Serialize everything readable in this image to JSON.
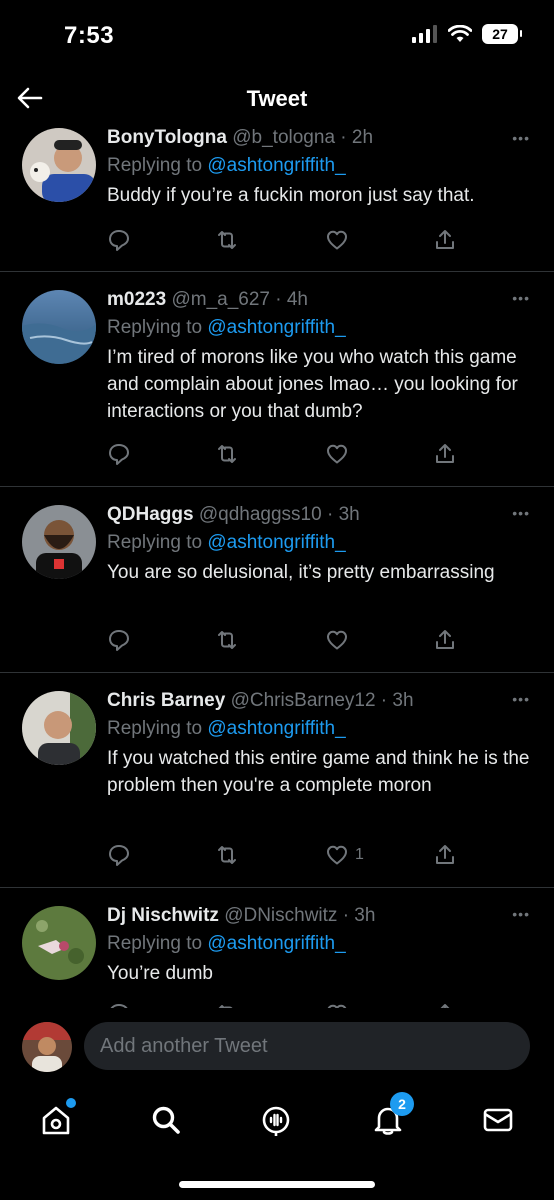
{
  "status_bar": {
    "time": "7:53",
    "battery": "27"
  },
  "header": {
    "title": "Tweet"
  },
  "tweets": [
    {
      "name": "BonyTologna",
      "handle": "@b_tologna · 2h",
      "replying_prefix": "Replying to",
      "replying_to": "@ashtongriffith_",
      "text": "Buddy if you’re a fuckin moron just say that.",
      "likes": ""
    },
    {
      "name": "m0223",
      "handle": "@m_a_627 · 4h",
      "replying_prefix": "Replying to",
      "replying_to": "@ashtongriffith_",
      "text": "I’m tired of morons like you who watch this game and complain about jones lmao… you looking for interactions or you that dumb?",
      "likes": ""
    },
    {
      "name": "QDHaggs",
      "handle": "@qdhaggss10 · 3h",
      "replying_prefix": "Replying to",
      "replying_to": "@ashtongriffith_",
      "text": "You are so delusional, it’s pretty embarrassing",
      "likes": ""
    },
    {
      "name": "Chris Barney",
      "handle": "@ChrisBarney12 · 3h",
      "replying_prefix": "Replying to",
      "replying_to": "@ashtongriffith_",
      "text": "If you watched this entire game and think he is the problem then you're a complete moron",
      "likes": "1"
    },
    {
      "name": "Dj Nischwitz",
      "handle": "@DNischwitz · 3h",
      "replying_prefix": "Replying to",
      "replying_to": "@ashtongriffith_",
      "text": "You’re dumb",
      "likes": ""
    }
  ],
  "compose": {
    "placeholder": "Add another Tweet"
  },
  "tabbar": {
    "notifications_badge": "2"
  },
  "colors": {
    "background": "#000000",
    "accent": "#1d9bf0",
    "muted": "#71767b",
    "divider": "#2f3336"
  }
}
